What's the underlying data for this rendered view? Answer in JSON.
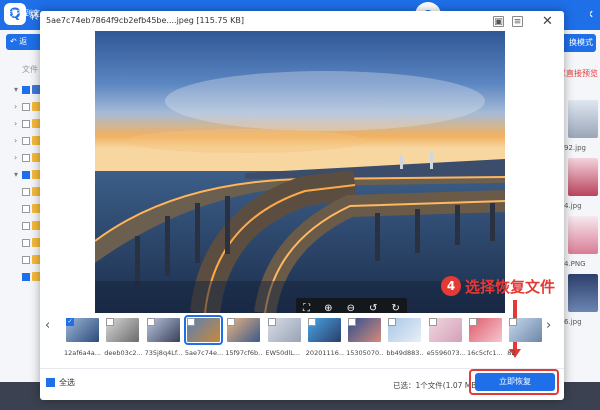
{
  "colors": {
    "accent": "#1e6fe8",
    "annotation": "#e53935"
  },
  "background_app": {
    "title_fragment": "转",
    "back_button": "返",
    "mode_button": "换模式",
    "hint": "以直接预览",
    "label_fragment": "文件",
    "tree_first_label": "软",
    "right_files": [
      "92.jpg",
      "4.jpg",
      "4.PNG",
      "6.jpg"
    ],
    "bottom_text": "找不到文"
  },
  "preview": {
    "title": "5ae7c74eb7864f9cb2efb45be....jpeg [115.75 KB]",
    "toolbar_icons": [
      "fit-screen-icon",
      "zoom-in-icon",
      "zoom-out-icon",
      "rotate-left-icon",
      "rotate-right-icon"
    ],
    "thumbnails": [
      {
        "name": "12af6a4a...",
        "checked": true,
        "colors": [
          "#9fb7d9",
          "#2b4b7a"
        ]
      },
      {
        "name": "deeb03c2...",
        "checked": false,
        "colors": [
          "#d9d9d9",
          "#6a6a6a"
        ]
      },
      {
        "name": "735j8q4Lf...",
        "checked": false,
        "colors": [
          "#b8c7e0",
          "#3a3f57"
        ]
      },
      {
        "name": "5ae7c74e...",
        "checked": false,
        "selected": true,
        "colors": [
          "#5a7fb6",
          "#c8893a"
        ]
      },
      {
        "name": "15f97cf6b...",
        "checked": false,
        "colors": [
          "#e8b482",
          "#3c5a8a"
        ]
      },
      {
        "name": "EW50dlL...",
        "checked": false,
        "colors": [
          "#d8dde6",
          "#97a3b6"
        ]
      },
      {
        "name": "20201116...",
        "checked": false,
        "colors": [
          "#49a5e6",
          "#2a3e6a"
        ]
      },
      {
        "name": "15305070...",
        "checked": false,
        "colors": [
          "#2f4f8f",
          "#d28b7b"
        ]
      },
      {
        "name": "bb49d883...",
        "checked": false,
        "colors": [
          "#a8c7e8",
          "#e9eef5"
        ]
      },
      {
        "name": "e5596073...",
        "checked": false,
        "colors": [
          "#f0d8e0",
          "#d4a0b8"
        ]
      },
      {
        "name": "16c5cfc1...",
        "checked": false,
        "colors": [
          "#e05a6a",
          "#f4c7cf"
        ]
      },
      {
        "name": "82",
        "checked": false,
        "colors": [
          "#c7d9ee",
          "#6c86a8"
        ]
      }
    ],
    "select_all_label": "全选",
    "selected_info": "已选：1个文件(1.07 MB)",
    "recover_button": "立即恢复"
  },
  "annotation": {
    "step": "4",
    "text": "选择恢复文件"
  }
}
